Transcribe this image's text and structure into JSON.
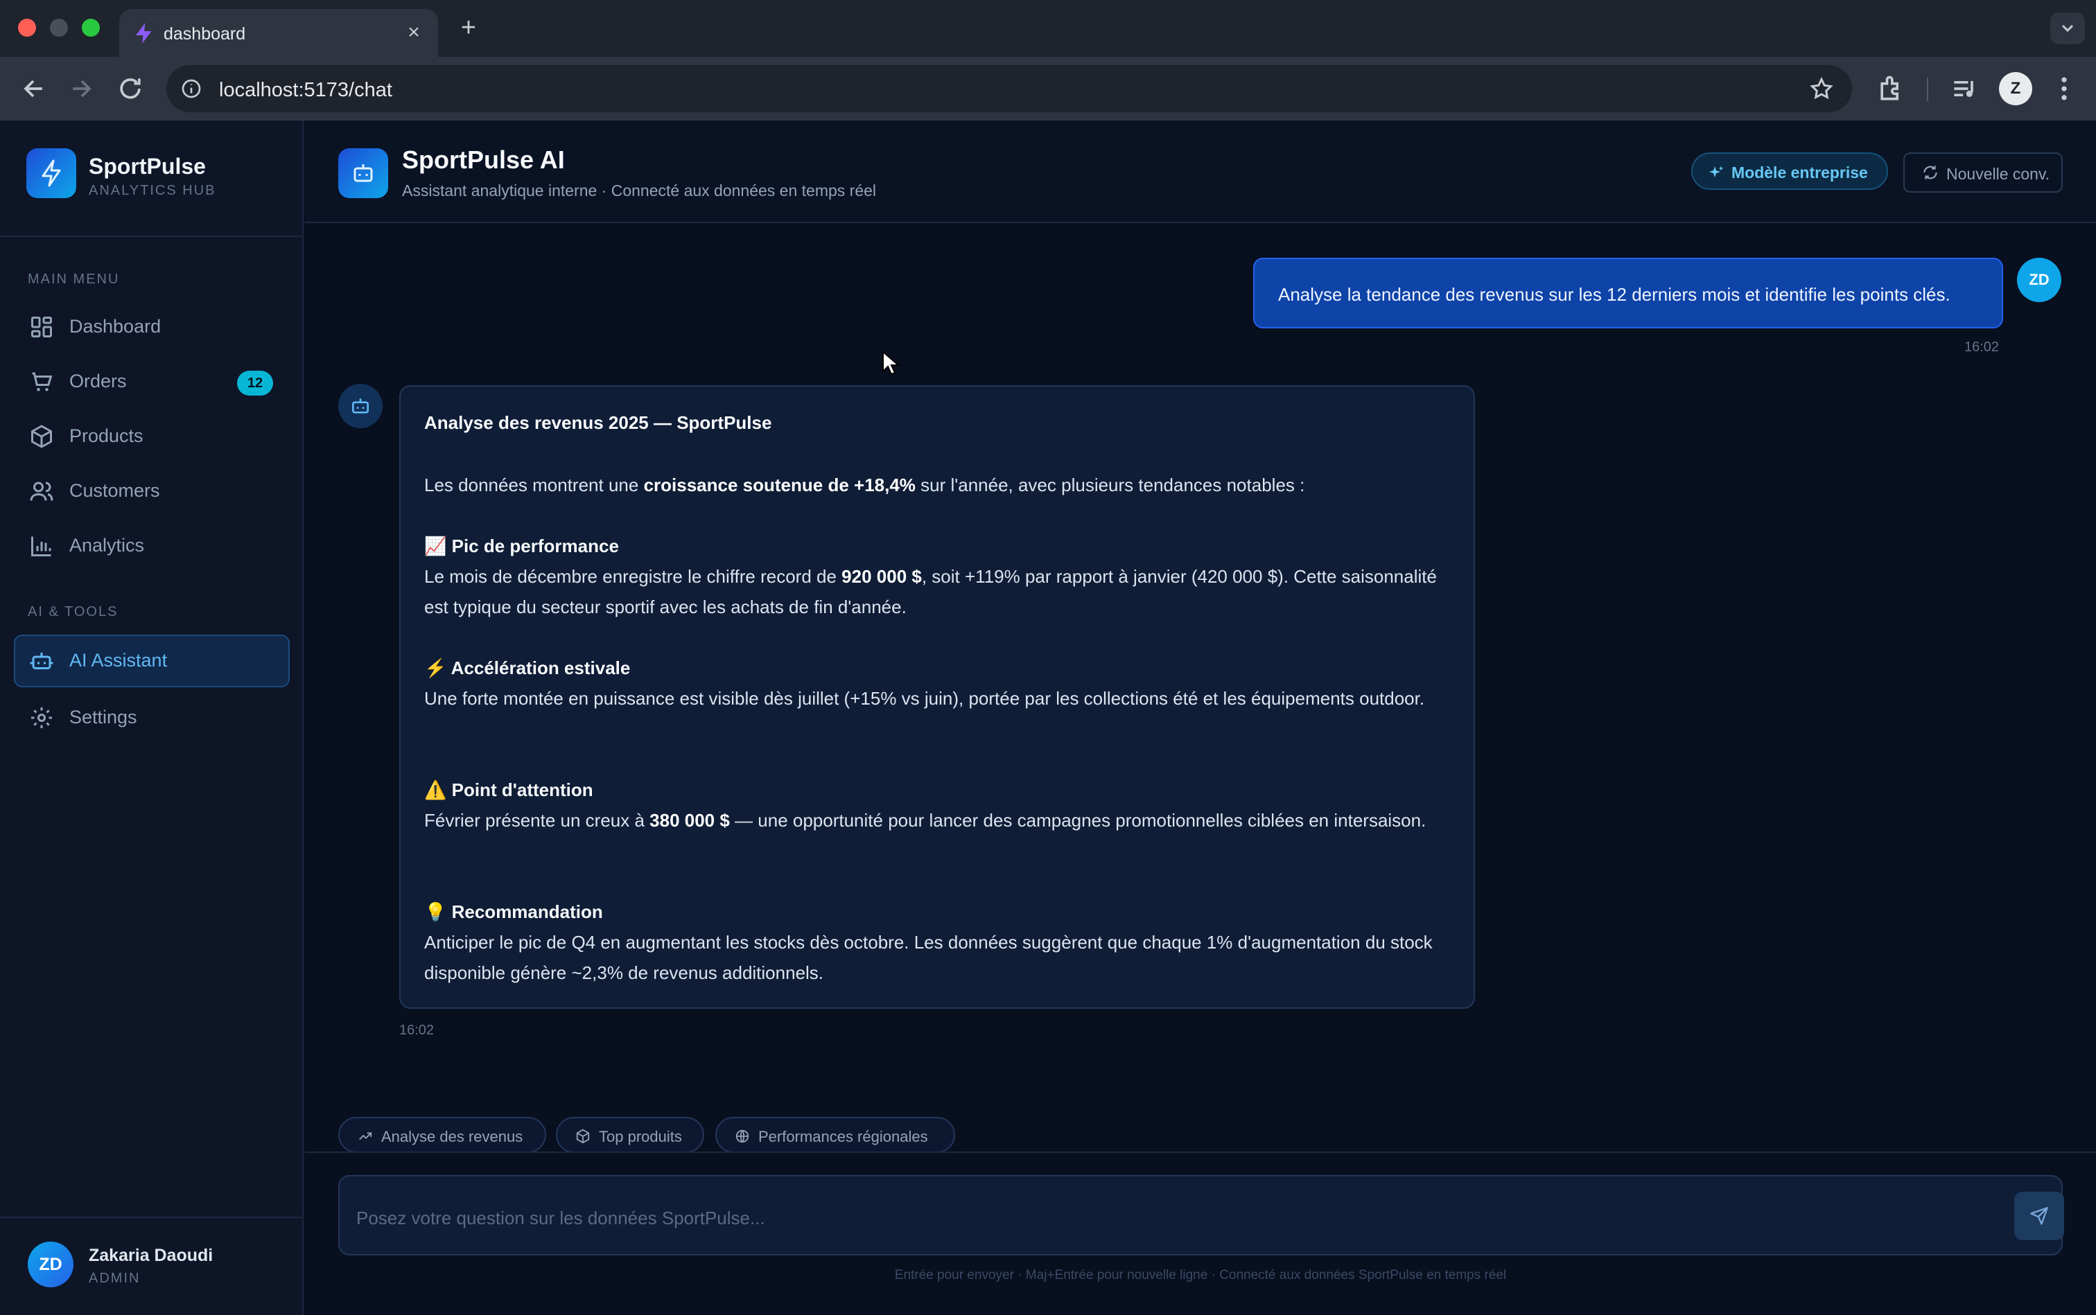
{
  "browser": {
    "tab_title": "dashboard",
    "url": "localhost:5173/chat",
    "profile_initial": "Z"
  },
  "sidebar": {
    "brand_name": "SportPulse",
    "brand_sub": "ANALYTICS HUB",
    "section_main": "MAIN MENU",
    "section_ai": "AI & TOOLS",
    "items": [
      {
        "label": "Dashboard",
        "icon": "grid-icon"
      },
      {
        "label": "Orders",
        "icon": "cart-icon",
        "badge": "12"
      },
      {
        "label": "Products",
        "icon": "box-icon"
      },
      {
        "label": "Customers",
        "icon": "users-icon"
      },
      {
        "label": "Analytics",
        "icon": "bar-chart-icon"
      }
    ],
    "ai_items": [
      {
        "label": "AI Assistant",
        "icon": "bot-icon",
        "active": true
      },
      {
        "label": "Settings",
        "icon": "gear-icon"
      }
    ],
    "user": {
      "initials": "ZD",
      "name": "Zakaria Daoudi",
      "role": "ADMIN"
    }
  },
  "header": {
    "title": "SportPulse AI",
    "subtitle": "Assistant analytique interne · Connecté aux données en temps réel",
    "model_button": "Modèle entreprise",
    "new_conv_button": "Nouvelle conv."
  },
  "chat": {
    "user_message": {
      "text": "Analyse la tendance des revenus sur les 12 derniers mois et identifie les points clés.",
      "avatar": "ZD",
      "time": "16:02"
    },
    "bot_message": {
      "time": "16:02",
      "title": "Analyse des revenus 2025 — SportPulse",
      "intro_pre": "Les données montrent une ",
      "intro_bold": "croissance soutenue de +18,4%",
      "intro_post": " sur l'année, avec plusieurs tendances notables :",
      "s1_icon": "📈",
      "s1_title": "Pic de performance",
      "s1_pre": "Le mois de décembre enregistre le chiffre record de ",
      "s1_bold": "920 000 $",
      "s1_post": ", soit +119% par rapport à janvier (420 000 $). Cette saisonnalité est typique du secteur sportif avec les achats de fin d'année.",
      "s2_icon": "⚡",
      "s2_title": "Accélération estivale",
      "s2_text": "Une forte montée en puissance est visible dès juillet (+15% vs juin), portée par les collections été et les équipements outdoor.",
      "s3_icon": "⚠️",
      "s3_title": "Point d'attention",
      "s3_pre": "Février présente un creux à ",
      "s3_bold": "380 000 $",
      "s3_post": " — une opportunité pour lancer des campagnes promotionnelles ciblées en intersaison.",
      "s4_icon": "💡",
      "s4_title": "Recommandation",
      "s4_text": "Anticiper le pic de Q4 en augmentant les stocks dès octobre. Les données suggèrent que chaque 1% d'augmentation du stock disponible génère ~2,3% de revenus additionnels."
    }
  },
  "suggestions": [
    "Analyse des revenus",
    "Top produits",
    "Performances régionales"
  ],
  "composer": {
    "placeholder": "Posez votre question sur les données SportPulse...",
    "hint": "Entrée pour envoyer · Maj+Entrée pour nouvelle ligne · Connecté aux données SportPulse en temps réel"
  }
}
